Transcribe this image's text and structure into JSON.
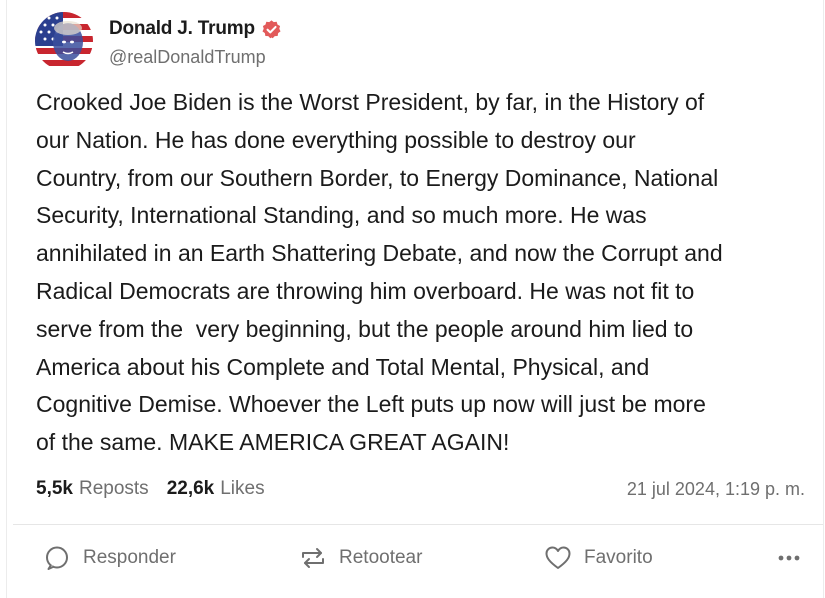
{
  "author": {
    "display_name": "Donald J. Trump",
    "handle": "@realDonaldTrump",
    "avatar_icon": "avatar-flag-portrait",
    "verified_icon": "verified-badge-icon",
    "verified_color": "#e25a5a"
  },
  "post": {
    "lines": [
      "Crooked Joe Biden is the Worst President, by far, in the History of",
      "our Nation. He has done everything possible to destroy our",
      "Country, from our Southern Border, to Energy Dominance, National",
      "Security, International Standing, and so much more. He was",
      "annihilated in an Earth Shattering Debate, and now the Corrupt and",
      "Radical Democrats are throwing him overboard. He was not fit to",
      "serve from the  very beginning, but the people around him lied to",
      "America about his Complete and Total Mental, Physical, and",
      "Cognitive Demise. Whoever the Left puts up now will just be more",
      "of the same. MAKE AMERICA GREAT AGAIN!"
    ]
  },
  "stats": {
    "reposts_count": "5,5k",
    "reposts_label": "Reposts",
    "likes_count": "22,6k",
    "likes_label": "Likes",
    "timestamp": "21 jul 2024, 1:19 p. m."
  },
  "actions": {
    "reply_label": "Responder",
    "reply_icon": "speech-bubble-icon",
    "retruth_label": "Retootear",
    "retruth_icon": "repost-arrows-icon",
    "favorite_label": "Favorito",
    "favorite_icon": "heart-icon",
    "more_icon": "more-dots-icon"
  },
  "colors": {
    "text": "#1b1b1b",
    "muted": "#6f6f6f",
    "divider": "#e6e6e6"
  }
}
